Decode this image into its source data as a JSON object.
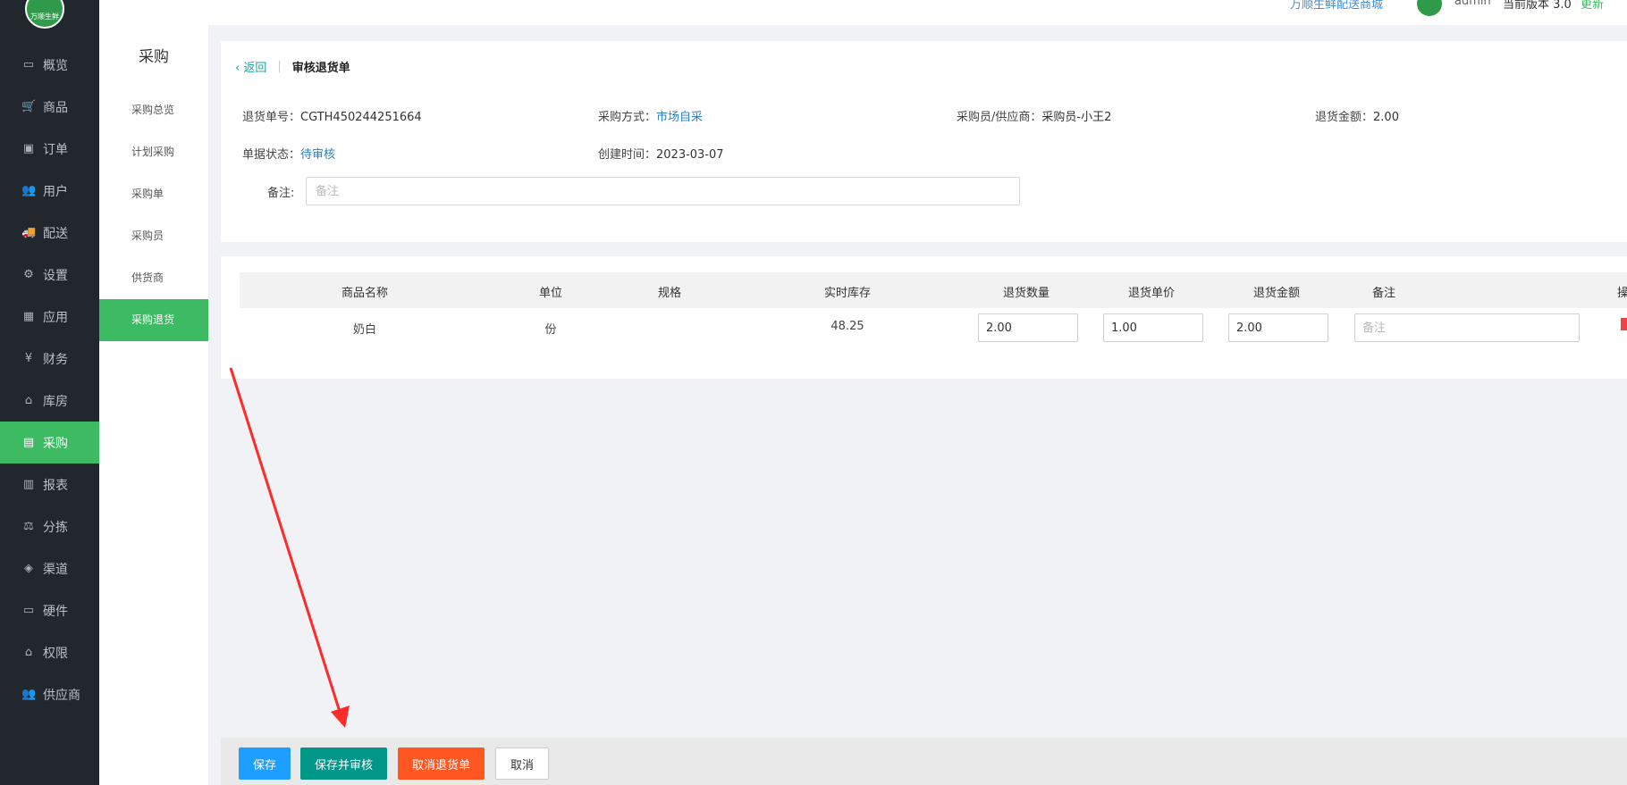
{
  "sidebar": {
    "logo_text": "万顺生鲜",
    "items": [
      {
        "label": "概览",
        "icon": "▭"
      },
      {
        "label": "商品",
        "icon": "🛒"
      },
      {
        "label": "订单",
        "icon": "▣"
      },
      {
        "label": "用户",
        "icon": "👥"
      },
      {
        "label": "配送",
        "icon": "🚚"
      },
      {
        "label": "设置",
        "icon": "⚙"
      },
      {
        "label": "应用",
        "icon": "▦"
      },
      {
        "label": "财务",
        "icon": "¥"
      },
      {
        "label": "库房",
        "icon": "⌂"
      },
      {
        "label": "采购",
        "icon": "▤"
      },
      {
        "label": "报表",
        "icon": "▥"
      },
      {
        "label": "分拣",
        "icon": "⚖"
      },
      {
        "label": "渠道",
        "icon": "◈"
      },
      {
        "label": "硬件",
        "icon": "▭"
      },
      {
        "label": "权限",
        "icon": "⌂"
      },
      {
        "label": "供应商",
        "icon": "👥"
      }
    ],
    "active_index": 9
  },
  "subsidebar": {
    "title": "采购",
    "items": [
      "采购总览",
      "计划采购",
      "采购单",
      "采购员",
      "供货商",
      "采购退货"
    ],
    "active_index": 5
  },
  "topbar": {
    "shop_link": "万顺生鲜配送商城",
    "user": "admin",
    "version_text": "当前版本 3.0",
    "update_link": "更新"
  },
  "info": {
    "back_label": "返回",
    "page_title": "审核退货单",
    "order_no_label": "退货单号：",
    "order_no": "CGTH450244251664",
    "method_label": "采购方式：",
    "method": "市场自采",
    "buyer_label": "采购员/供应商：",
    "buyer": "采购员-小王2",
    "amount_label": "退货金额：",
    "amount": "2.00",
    "status_label": "单据状态：",
    "status": "待审核",
    "created_label": "创建时间：",
    "created": "2023-03-07",
    "remark_label": "备注:",
    "remark_placeholder": "备注"
  },
  "table": {
    "columns": [
      "商品名称",
      "单位",
      "规格",
      "实时库存",
      "退货数量",
      "退货单价",
      "退货金额",
      "备注",
      "操作"
    ],
    "rows": [
      {
        "name": "奶白",
        "unit": "份",
        "spec": "",
        "stock": "48.25",
        "qty": "2.00",
        "price": "1.00",
        "amount": "2.00",
        "remark_placeholder": "备注"
      }
    ]
  },
  "buttons": {
    "save": "保存",
    "save_audit": "保存并审核",
    "cancel_order": "取消退货单",
    "cancel": "取消"
  },
  "colors": {
    "accent_green": "#3dbb63",
    "sidebar_bg": "#22262d",
    "annotation_red": "#ff2a2a"
  }
}
